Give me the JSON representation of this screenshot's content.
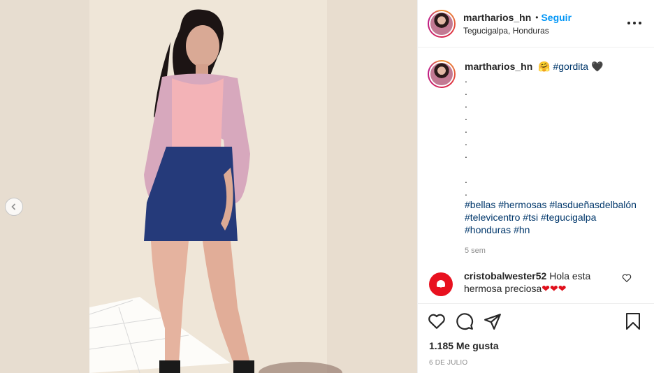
{
  "post": {
    "username": "martharios_hn",
    "follow_label": "Seguir",
    "separator": "•",
    "location": "Tegucigalpa, Honduras"
  },
  "caption": {
    "username": "martharios_hn",
    "emoji": "🤗",
    "hashtag_main": "#gordita",
    "heart": "🖤",
    "dot": ".",
    "hashtags": [
      "#bellas",
      "#hermosas",
      "#lasdueñasdelbalón",
      "#televicentro",
      "#tsi",
      "#tegucigalpa",
      "#honduras",
      "#hn"
    ],
    "time_ago": "5 sem"
  },
  "comment": {
    "username": "cristobalwester52",
    "text": "Hola esta hermosa preciosa",
    "hearts": "❤❤❤"
  },
  "footer": {
    "likes": "1.185 Me gusta",
    "date": "6 DE JULIO"
  },
  "icons": {
    "avatar": "profile-avatar",
    "more": "more-options-icon",
    "like": "heart-icon",
    "comment": "comment-icon",
    "share": "share-icon",
    "save": "bookmark-icon",
    "prev": "chevron-left-icon"
  },
  "colors": {
    "accent": "#0095f6",
    "hashtag": "#00376b",
    "text": "#262626",
    "muted": "#8e8e8e",
    "heart_red": "#e0101c"
  }
}
